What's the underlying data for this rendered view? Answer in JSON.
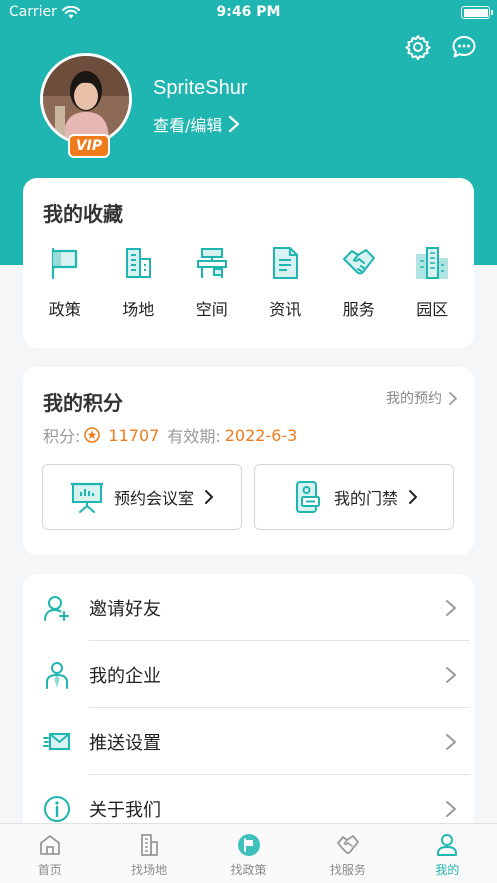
{
  "status_bar": {
    "carrier": "Carrier",
    "time": "9:46 PM"
  },
  "colors": {
    "primary": "#1fb5b0",
    "accent": "#f07b1a"
  },
  "profile": {
    "username": "SpriteShur",
    "edit_label": "查看/编辑",
    "badge": "VIP"
  },
  "favorites": {
    "title": "我的收藏",
    "items": [
      {
        "label": "政策",
        "icon": "flag-icon"
      },
      {
        "label": "场地",
        "icon": "building-icon"
      },
      {
        "label": "空间",
        "icon": "desk-icon"
      },
      {
        "label": "资讯",
        "icon": "document-icon"
      },
      {
        "label": "服务",
        "icon": "handshake-icon"
      },
      {
        "label": "园区",
        "icon": "city-icon"
      }
    ]
  },
  "points": {
    "title": "我的积分",
    "booking_link": "我的预约",
    "points_label": "积分:",
    "points_value": "11707",
    "validity_label": "有效期:",
    "validity_date": "2022-6-3",
    "meeting_button": "预约会议室",
    "access_button": "我的门禁"
  },
  "menu": [
    {
      "label": "邀请好友",
      "icon": "add-user-icon"
    },
    {
      "label": "我的企业",
      "icon": "business-person-icon"
    },
    {
      "label": "推送设置",
      "icon": "send-mail-icon"
    },
    {
      "label": "关于我们",
      "icon": "info-icon"
    }
  ],
  "tabbar": [
    {
      "label": "首页",
      "icon": "home-icon",
      "active": false
    },
    {
      "label": "找场地",
      "icon": "building-icon",
      "active": false
    },
    {
      "label": "找政策",
      "icon": "flag-icon",
      "active": false
    },
    {
      "label": "找服务",
      "icon": "handshake-icon",
      "active": false
    },
    {
      "label": "我的",
      "icon": "person-icon",
      "active": true
    }
  ]
}
